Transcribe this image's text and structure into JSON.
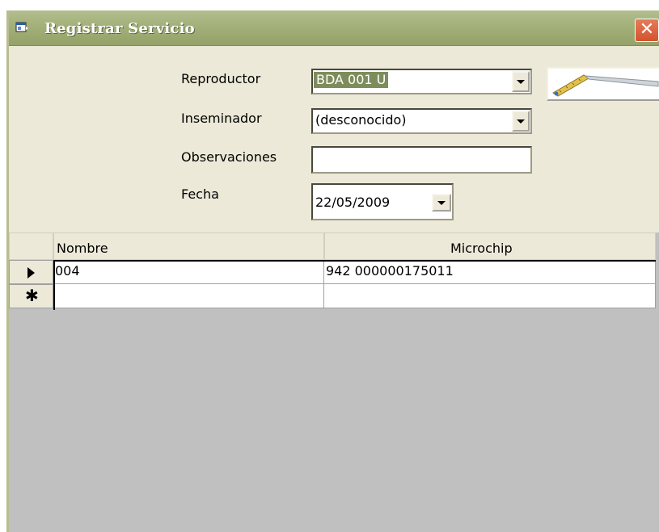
{
  "window": {
    "title": "Registrar Servicio",
    "close_glyph": "✕"
  },
  "form": {
    "reproductor": {
      "label": "Reproductor",
      "value": "BDA 001 U"
    },
    "inseminador": {
      "label": "Inseminador",
      "value": "(desconocido)"
    },
    "observaciones": {
      "label": "Observaciones",
      "value": ""
    },
    "fecha": {
      "label": "Fecha",
      "value": "22/05/2009"
    }
  },
  "tool_button": {
    "icon": "ruler-tool-icon"
  },
  "grid": {
    "columns": [
      "Nombre",
      "Microchip"
    ],
    "rows": [
      {
        "nombre": "004",
        "microchip": "942 000000175011"
      }
    ],
    "new_row_marker": "✱"
  },
  "colors": {
    "titlebar": "#a3b079",
    "selection": "#7d8c5c",
    "close": "#d3532e",
    "grid_background": "#c0c0c0"
  }
}
